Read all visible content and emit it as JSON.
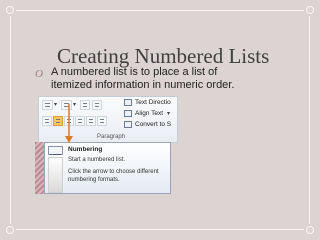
{
  "slide": {
    "title": "Creating Numbered Lists",
    "bullet_marker": "O",
    "bullet_text": "A numbered list  is to place a list of itemized information in numeric order."
  },
  "ribbon": {
    "text_direction_label": "Text Directio",
    "align_text_label": "Align Text",
    "convert_label": "Convert to S",
    "group_label": "Paragraph"
  },
  "tooltip": {
    "title": "Numbering",
    "line1": "Start a numbered list.",
    "line2": "Click the arrow to choose different numbering formats."
  },
  "colors": {
    "background": "#dcd3d3",
    "arrow": "#e07a22",
    "selected_button": "#f7c85e"
  }
}
